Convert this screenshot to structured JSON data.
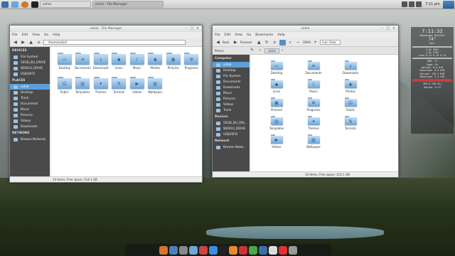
{
  "top_panel": {
    "tasks": [
      {
        "label": "sohel"
      },
      {
        "label": "sohel - File Manager"
      }
    ],
    "clock": "7:11 pm"
  },
  "window_left": {
    "title": "sohel - File Manager",
    "menu": [
      "File",
      "Edit",
      "View",
      "Go",
      "Help"
    ],
    "location": "/home/sohel/",
    "sidebar": {
      "devices_head": "DEVICES",
      "devices": [
        "File System",
        "50GB_BU_DRIVE",
        "WD610_DRIVE",
        "USB20FD"
      ],
      "places_head": "PLACES",
      "places": [
        "sohel",
        "Desktop",
        "Trash",
        "Documents",
        "Music",
        "Pictures",
        "Videos",
        "Downloads"
      ],
      "network_head": "NETWORK",
      "network": [
        "Browse Network"
      ]
    },
    "items": [
      "Desktop",
      "Documents",
      "Downloads",
      "Icons",
      "Music",
      "Photos",
      "Pictures",
      "Programs",
      "Public",
      "Templates",
      "Themes",
      "Torrents",
      "Videos",
      "Wallpaper"
    ],
    "status": "14 items, Free space: 214.1 GB"
  },
  "window_right": {
    "title": "sohel",
    "menu": [
      "File",
      "Edit",
      "View",
      "Go",
      "Bookmarks",
      "Help"
    ],
    "toolbar": {
      "back": "Back",
      "forward": "Forward",
      "zoom": "100%",
      "view_mode": "Icon View"
    },
    "places_label": "Places",
    "path_button": "sohel",
    "sidebar": {
      "computer_head": "Computer",
      "computer": [
        "sohel",
        "Desktop",
        "File System",
        "Documents",
        "Downloads",
        "Music",
        "Pictures",
        "Videos",
        "Trash"
      ],
      "devices_head": "Devices",
      "devices": [
        "50GB_BU_DRI...",
        "WD610_DRIVE",
        "USB20FD"
      ],
      "network_head": "Network",
      "network": [
        "Browse Netw..."
      ]
    },
    "items": [
      "Desktop",
      "Documents",
      "Downloads",
      "Icons",
      "Music",
      "Photos",
      "Pictures",
      "Programs",
      "Public",
      "Templates",
      "Themes",
      "Torrents",
      "Videos",
      "Wallpaper"
    ],
    "status": "14 items, Free space: 214.1 GB"
  },
  "conky": {
    "time": "7:11:32",
    "date": "Wednesday 05/2013",
    "temp": "74°",
    "weather": "Fair",
    "cpu1": "1.0% CPU1",
    "cpu2": "1.0% CPU2",
    "load": "Load 0.14 0.19 0.15",
    "ram": "RAM: 7%",
    "swap": "Swap: 0%",
    "upload": "Upload: 0.0 KiB",
    "download": "Download: 0.0 KiB",
    "net_up_total": "Upload: 176.1 MiB",
    "net_down_total": "Download: 2.3 GiB",
    "disk": "209.8 (86.5%)",
    "uptime": "Uptime: 6:37"
  },
  "dock": {
    "icons": [
      "home-icon",
      "browser-icon",
      "settings-icon",
      "files-icon",
      "tools-icon",
      "chrome-icon",
      "terminal-icon",
      "music-icon",
      "media-icon",
      "image-icon",
      "download-icon",
      "calendar-icon",
      "mail-icon",
      "trash-icon"
    ]
  },
  "colors": {
    "folder_light": "#c6def2",
    "folder_dark": "#6ea6d6",
    "sidebar_bg": "#4a4a4a",
    "selection": "#5aa0da"
  }
}
